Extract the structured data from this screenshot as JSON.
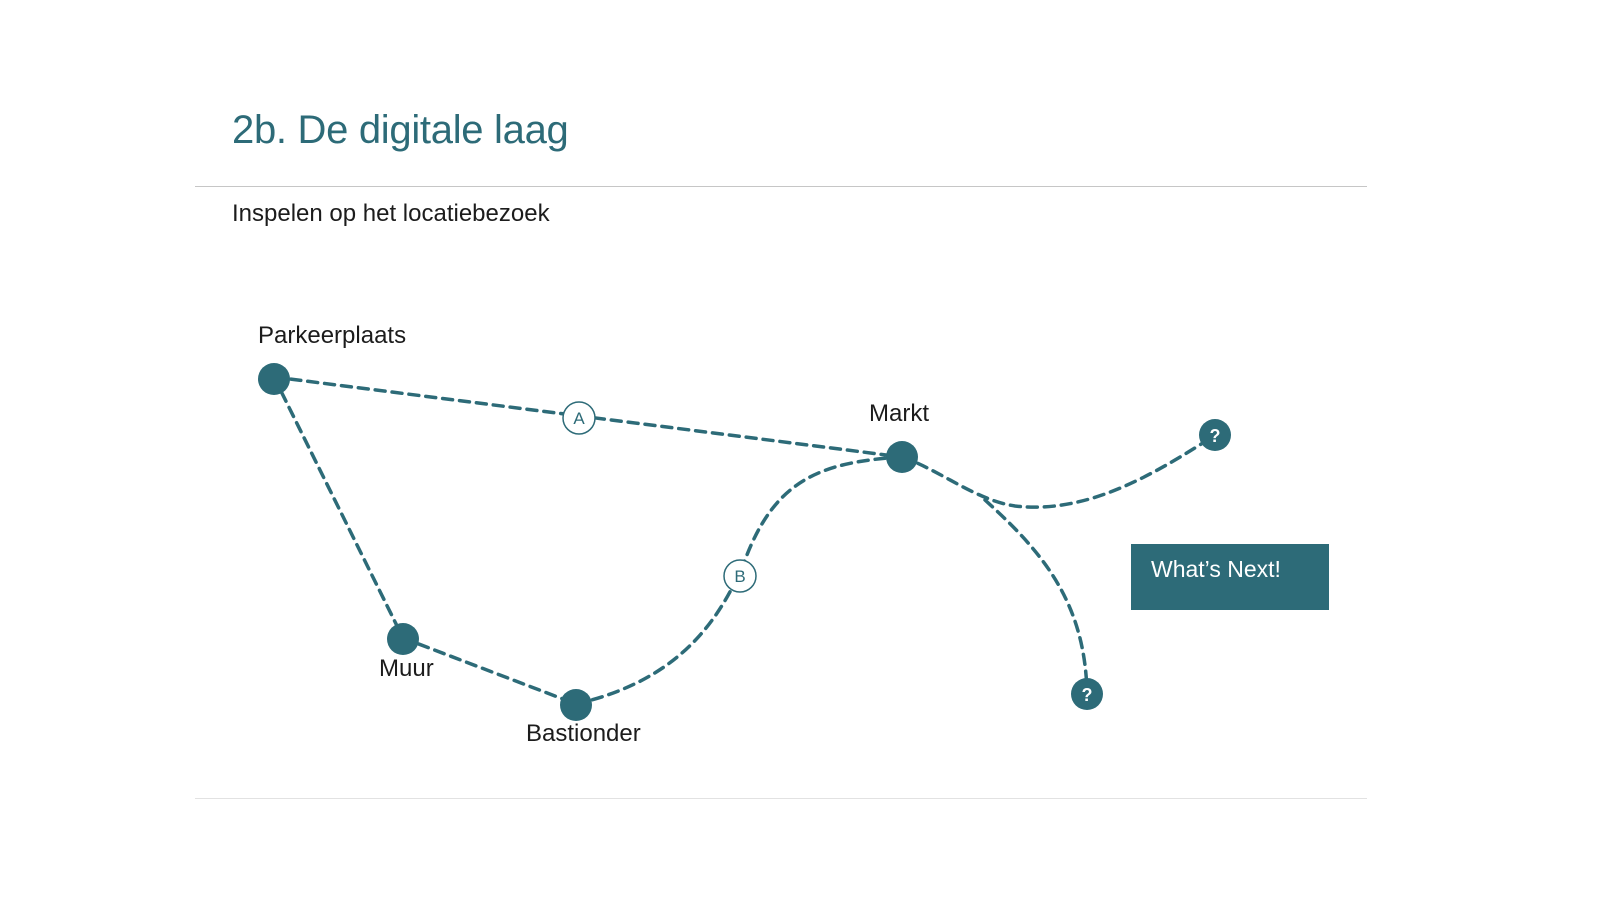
{
  "slide": {
    "title": "2b. De digitale laag",
    "subtitle": "Inspelen op het locatiebezoek"
  },
  "diagram": {
    "nodes": [
      {
        "id": "parkeerplaats",
        "label": "Parkeerplaats"
      },
      {
        "id": "markt",
        "label": "Markt"
      },
      {
        "id": "muur",
        "label": "Muur"
      },
      {
        "id": "bastionder",
        "label": "Bastionder"
      }
    ],
    "routes": [
      {
        "id": "A",
        "label": "A",
        "from": "parkeerplaats",
        "to": "markt"
      },
      {
        "id": "B",
        "label": "B",
        "from": "bastionder",
        "to": "markt"
      }
    ],
    "unknown_destinations": [
      {
        "id": "unknown-1",
        "label": "?"
      },
      {
        "id": "unknown-2",
        "label": "?"
      }
    ],
    "color": "#2d6b78"
  },
  "cta": {
    "label": "What’s Next!"
  }
}
